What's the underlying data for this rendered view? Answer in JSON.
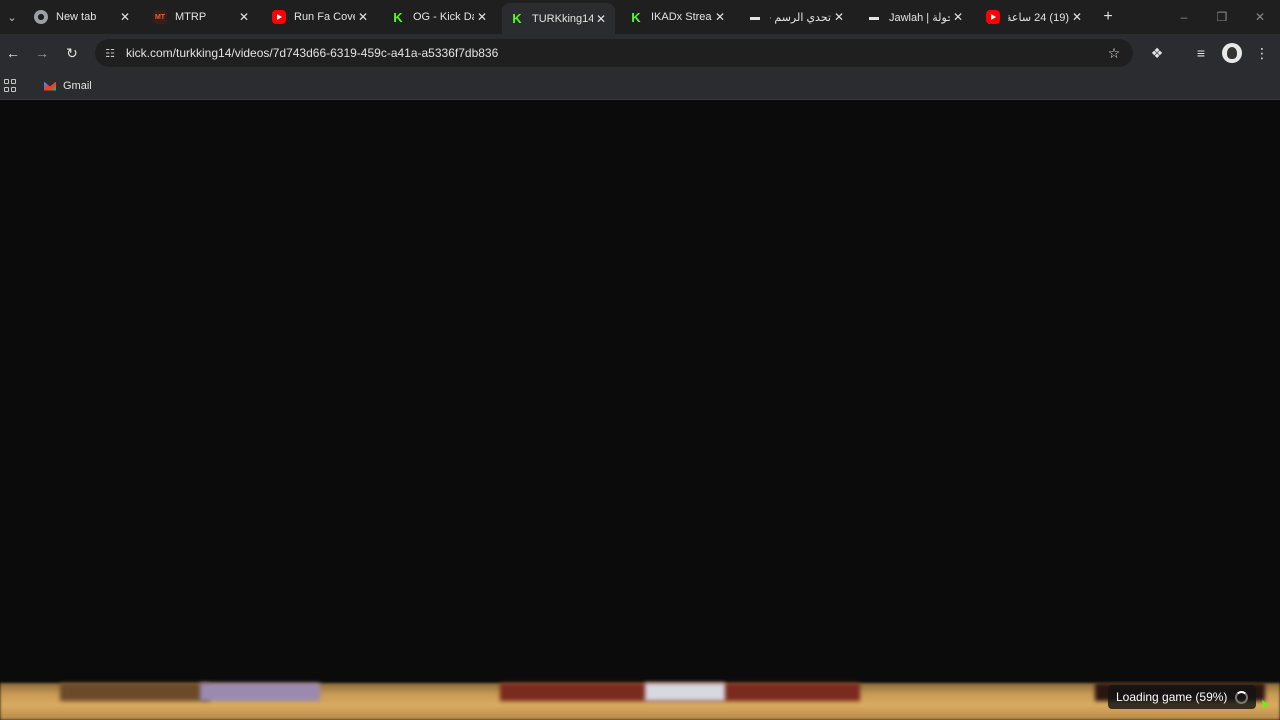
{
  "tabs": [
    {
      "title": "New tab",
      "favicon": "chrome-icon",
      "active": false
    },
    {
      "title": "MTRP",
      "favicon": "mtrp-icon",
      "active": false
    },
    {
      "title": "Run Fa Cover",
      "favicon": "youtube-icon",
      "active": false
    },
    {
      "title": "OG - Kick Da",
      "favicon": "kick-icon",
      "active": false
    },
    {
      "title": "TURKking14",
      "favicon": "kick-icon",
      "active": true
    },
    {
      "title": "IKADx Stream",
      "favicon": "kick-icon",
      "active": false
    },
    {
      "title": "تحدي الرسم -",
      "favicon": "jawlah-icon",
      "active": false
    },
    {
      "title": "Jawlah | جولة",
      "favicon": "jawlah-icon",
      "active": false
    },
    {
      "title": "(19) 24 ساعة",
      "favicon": "youtube-icon",
      "active": false
    }
  ],
  "address_bar": {
    "url": "kick.com/turkking14/videos/7d743d66-6319-459c-a41a-a5336f7db836"
  },
  "bookmarks": [
    {
      "label": "Gmail",
      "icon": "gmail-icon"
    }
  ],
  "player": {
    "loading_text": "Loading game (59%)",
    "loading_progress_percent": 59
  },
  "colors": {
    "kick_brand": "#53fc18",
    "youtube_brand": "#ff0000",
    "tabstrip_bg": "#1f1f1f",
    "toolbar_bg": "#2b2c2f"
  }
}
